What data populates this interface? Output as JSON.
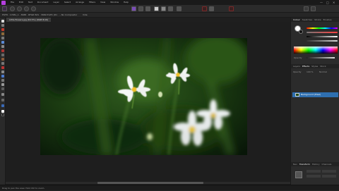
{
  "menubar": {
    "items": [
      "File",
      "Edit",
      "Text",
      "Document",
      "Layer",
      "Select",
      "Arrange",
      "Filters",
      "View",
      "Window",
      "Help"
    ],
    "window_controls": [
      "—",
      "□",
      "✕"
    ],
    "accent": "#b53fe0"
  },
  "context_toolbar": {
    "left_text": "HSFR · 1748x_1 · 3988 · RFGR W/S · 3669 P1/P1 (R1 · ...",
    "middle_text": "No Compositor",
    "sub_text": "Vide"
  },
  "document": {
    "tab_label": "Little flowers.jpg (64.5%) (RGB 8/16)"
  },
  "panel": {
    "top_tabs": [
      "Colour",
      "Swatches",
      "Stroke",
      "Brushes"
    ],
    "sliders": [
      {
        "name": "H",
        "value": "0",
        "color": "#ff4040"
      },
      {
        "name": "S",
        "value": "0",
        "color": "#40ff40"
      },
      {
        "name": "L",
        "value": "0",
        "color": "#4040ff"
      },
      {
        "name": "A",
        "value": "100",
        "color": "#dddddd"
      }
    ],
    "opacity_label": "Opacity",
    "layer_tabs": [
      "Layers",
      "Effects",
      "Styles",
      "Stock"
    ],
    "layer_header": [
      "Opacity",
      "100 %",
      "Normal"
    ],
    "layer_name": "Background (Pixel)",
    "bottom_tabs": [
      "Nav",
      "Transform",
      "History",
      "Channels"
    ]
  },
  "status": {
    "text": "Drag to pan the view. Hold Ctrl to zoom."
  },
  "colors": {
    "selection": "#2f6fb0",
    "background": "#232323"
  }
}
